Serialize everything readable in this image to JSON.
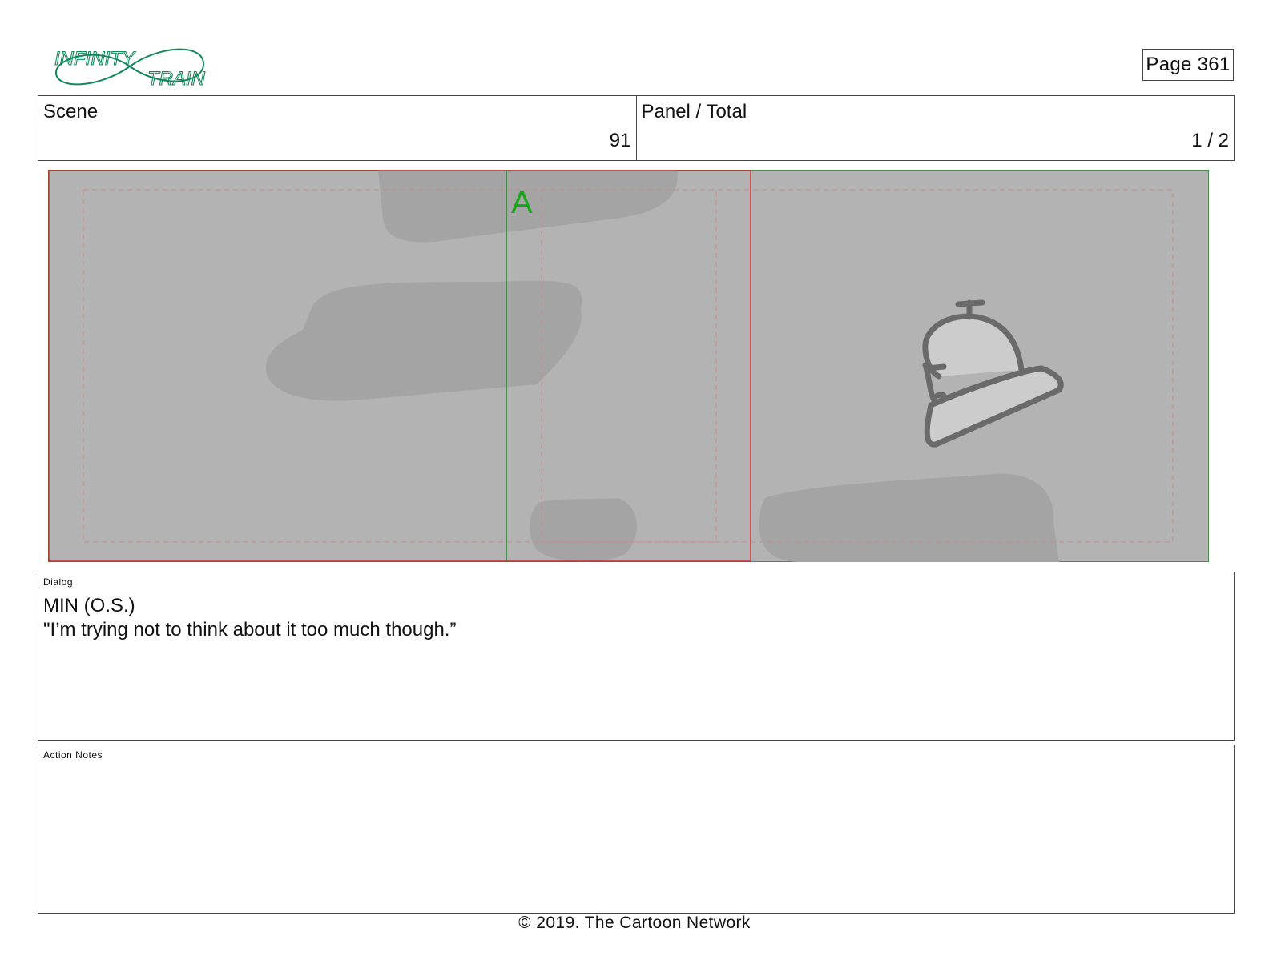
{
  "header": {
    "logo_line1": "INFINITY",
    "logo_line2": "TRAIN",
    "page_label": "Page 361",
    "scene": {
      "label": "Scene",
      "value": "91"
    },
    "panel_total": {
      "label": "Panel / Total",
      "value": "1 / 2"
    }
  },
  "panel": {
    "marker_letter": "A",
    "colors": {
      "background": "#b3b3b3",
      "safe_area": "#cc3333",
      "field_guide": "#2e7d32",
      "marker": "#17a817"
    }
  },
  "dialog": {
    "label": "Dialog",
    "speaker": "MIN (O.S.)",
    "line": "\"I’m trying not to think about it too much though.”"
  },
  "action_notes": {
    "label": "Action Notes",
    "text": ""
  },
  "footer": {
    "copyright": "© 2019. The Cartoon Network"
  }
}
